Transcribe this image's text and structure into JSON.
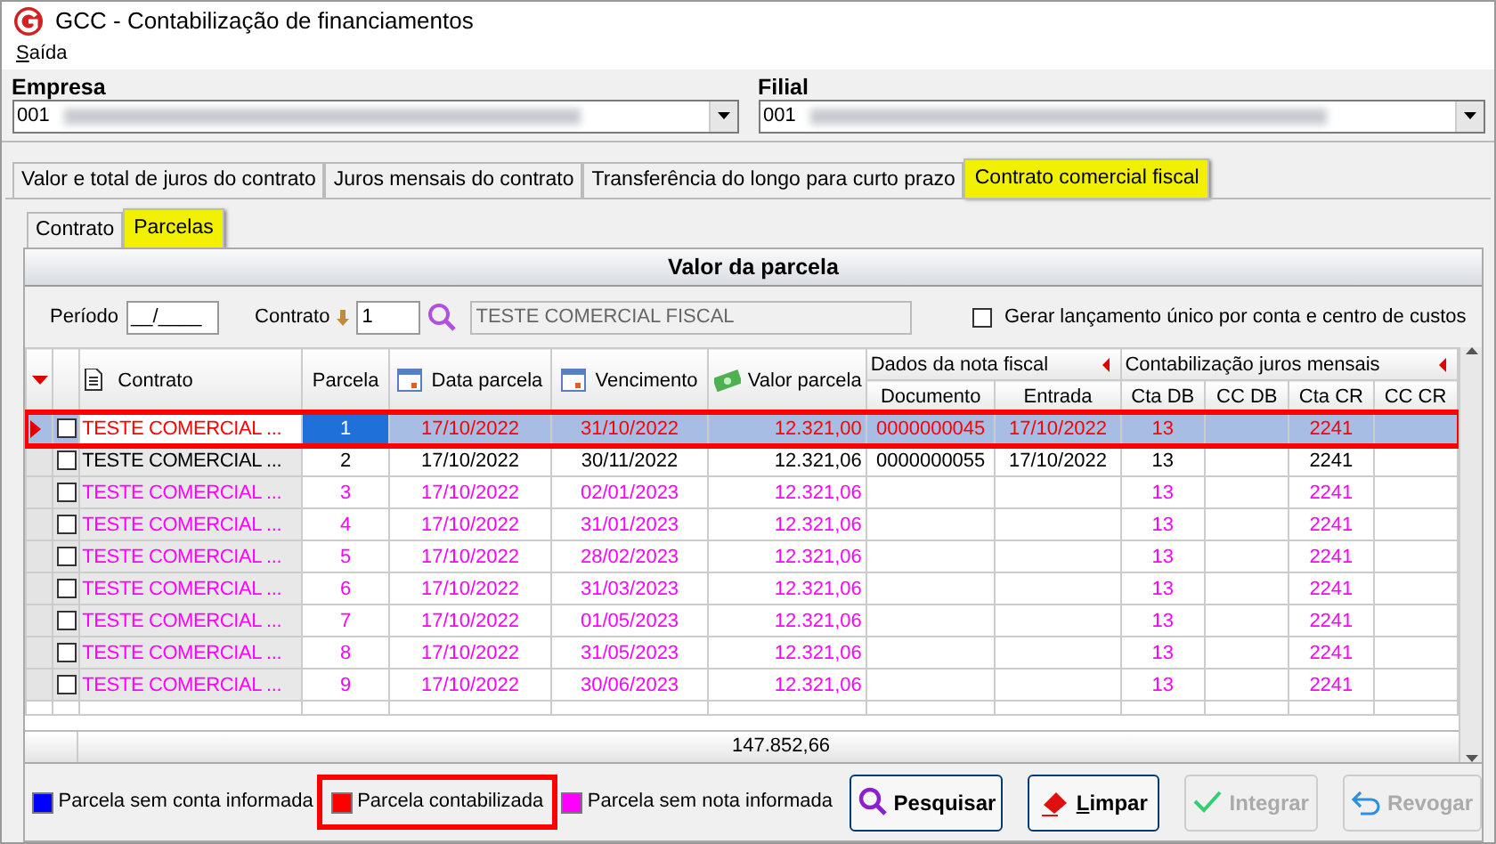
{
  "window": {
    "title": "GCC - Contabilização de financiamentos"
  },
  "menu": [
    {
      "label": "Saída"
    }
  ],
  "empresa": {
    "label": "Empresa",
    "code": "001"
  },
  "filial": {
    "label": "Filial",
    "code": "001"
  },
  "tabs": [
    {
      "label": "Valor e total de juros do contrato",
      "selected": false,
      "highlighted": false
    },
    {
      "label": "Juros mensais do contrato",
      "selected": false,
      "highlighted": false
    },
    {
      "label": "Transferência do longo para curto prazo",
      "selected": false,
      "highlighted": false
    },
    {
      "label": "Contrato comercial fiscal",
      "selected": true,
      "highlighted": true
    }
  ],
  "subtabs": [
    {
      "label": "Contrato",
      "selected": false,
      "highlighted": false
    },
    {
      "label": "Parcelas",
      "selected": true,
      "highlighted": true
    }
  ],
  "group_title": "Valor da parcela",
  "filters": {
    "periodo_label": "Período",
    "periodo_value": "__/____",
    "contrato_label": "Contrato",
    "contrato_value": "1",
    "description": "TESTE COMERCIAL FISCAL",
    "single_entry_label": "Gerar lançamento único por conta e centro de custos",
    "single_entry_checked": false
  },
  "grid": {
    "groups": [
      {
        "label": "Dados da nota fiscal"
      },
      {
        "label": "Contabilização juros mensais"
      }
    ],
    "columns": [
      {
        "label": "Contrato"
      },
      {
        "label": "Parcela"
      },
      {
        "label": "Data parcela"
      },
      {
        "label": "Vencimento"
      },
      {
        "label": "Valor parcela"
      },
      {
        "label": "Documento"
      },
      {
        "label": "Entrada"
      },
      {
        "label": "Cta DB"
      },
      {
        "label": "CC DB"
      },
      {
        "label": "Cta CR"
      },
      {
        "label": "CC CR"
      }
    ],
    "rows": [
      {
        "selected": true,
        "outlined": true,
        "checked": false,
        "color": "#ff0000",
        "cells": [
          "TESTE COMERCIAL ...",
          "1",
          "17/10/2022",
          "31/10/2022",
          "12.321,00",
          "0000000045",
          "17/10/2022",
          "13",
          "",
          "2241",
          ""
        ]
      },
      {
        "selected": false,
        "outlined": false,
        "checked": false,
        "color": "#000000",
        "cells": [
          "TESTE COMERCIAL ...",
          "2",
          "17/10/2022",
          "30/11/2022",
          "12.321,06",
          "0000000055",
          "17/10/2022",
          "13",
          "",
          "2241",
          ""
        ]
      },
      {
        "selected": false,
        "outlined": false,
        "checked": false,
        "color": "#ff00ff",
        "cells": [
          "TESTE COMERCIAL ...",
          "3",
          "17/10/2022",
          "02/01/2023",
          "12.321,06",
          "",
          "",
          "13",
          "",
          "2241",
          ""
        ]
      },
      {
        "selected": false,
        "outlined": false,
        "checked": false,
        "color": "#ff00ff",
        "cells": [
          "TESTE COMERCIAL ...",
          "4",
          "17/10/2022",
          "31/01/2023",
          "12.321,06",
          "",
          "",
          "13",
          "",
          "2241",
          ""
        ]
      },
      {
        "selected": false,
        "outlined": false,
        "checked": false,
        "color": "#ff00ff",
        "cells": [
          "TESTE COMERCIAL ...",
          "5",
          "17/10/2022",
          "28/02/2023",
          "12.321,06",
          "",
          "",
          "13",
          "",
          "2241",
          ""
        ]
      },
      {
        "selected": false,
        "outlined": false,
        "checked": false,
        "color": "#ff00ff",
        "cells": [
          "TESTE COMERCIAL ...",
          "6",
          "17/10/2022",
          "31/03/2023",
          "12.321,06",
          "",
          "",
          "13",
          "",
          "2241",
          ""
        ]
      },
      {
        "selected": false,
        "outlined": false,
        "checked": false,
        "color": "#ff00ff",
        "cells": [
          "TESTE COMERCIAL ...",
          "7",
          "17/10/2022",
          "01/05/2023",
          "12.321,06",
          "",
          "",
          "13",
          "",
          "2241",
          ""
        ]
      },
      {
        "selected": false,
        "outlined": false,
        "checked": false,
        "color": "#ff00ff",
        "cells": [
          "TESTE COMERCIAL ...",
          "8",
          "17/10/2022",
          "31/05/2023",
          "12.321,06",
          "",
          "",
          "13",
          "",
          "2241",
          ""
        ]
      },
      {
        "selected": false,
        "outlined": false,
        "checked": false,
        "color": "#ff00ff",
        "cells": [
          "TESTE COMERCIAL ...",
          "9",
          "17/10/2022",
          "30/06/2023",
          "12.321,06",
          "",
          "",
          "13",
          "",
          "2241",
          ""
        ]
      }
    ],
    "total": "147.852,66"
  },
  "legend": [
    {
      "label": "Parcela sem conta informada",
      "color": "#0000ff",
      "outlined": false
    },
    {
      "label": "Parcela contabilizada",
      "color": "#ff0000",
      "outlined": true
    },
    {
      "label": "Parcela sem nota informada",
      "color": "#ff00ff",
      "outlined": false
    }
  ],
  "buttons": [
    {
      "label": "Pesquisar",
      "disabled": false
    },
    {
      "label": "Limpar",
      "disabled": false
    },
    {
      "label": "Integrar",
      "disabled": true
    },
    {
      "label": "Revogar",
      "disabled": true
    }
  ]
}
